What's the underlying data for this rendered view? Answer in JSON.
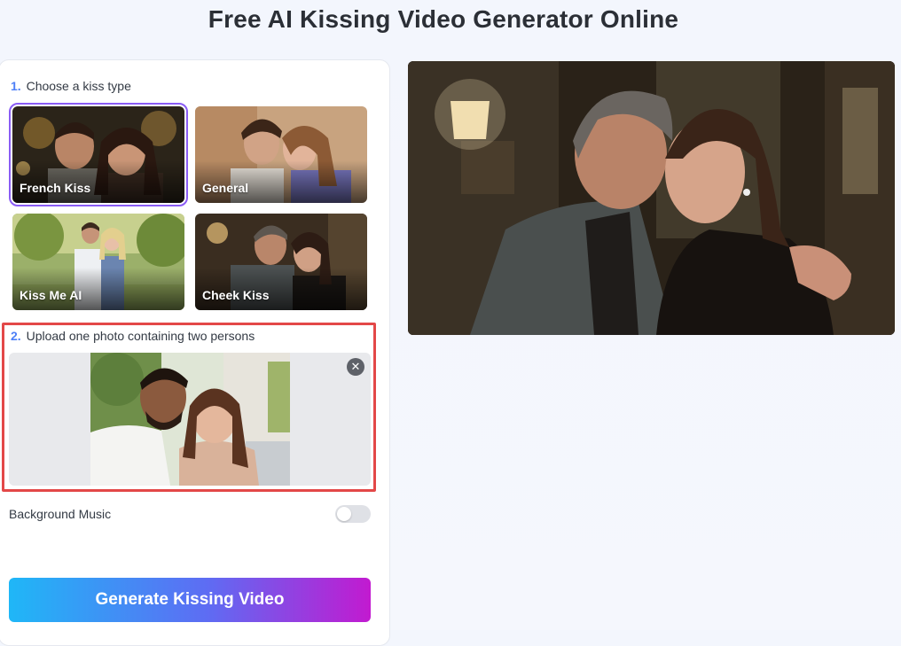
{
  "header": {
    "title": "Free AI Kissing Video Generator Online"
  },
  "step1": {
    "number": "1.",
    "label": "Choose a kiss type",
    "options": [
      {
        "label": "French Kiss",
        "selected": true
      },
      {
        "label": "General",
        "selected": false
      },
      {
        "label": "Kiss Me AI",
        "selected": false
      },
      {
        "label": "Cheek Kiss",
        "selected": false
      }
    ]
  },
  "step2": {
    "number": "2.",
    "label": "Upload one photo containing two persons",
    "remove_icon": "close-icon"
  },
  "settings": {
    "background_music_label": "Background Music",
    "background_music_enabled": false
  },
  "actions": {
    "generate_label": "Generate Kissing Video"
  },
  "colors": {
    "accent": "#4d7ff7",
    "highlight_border": "#e34848",
    "selected_border": "#8a5cf5"
  }
}
